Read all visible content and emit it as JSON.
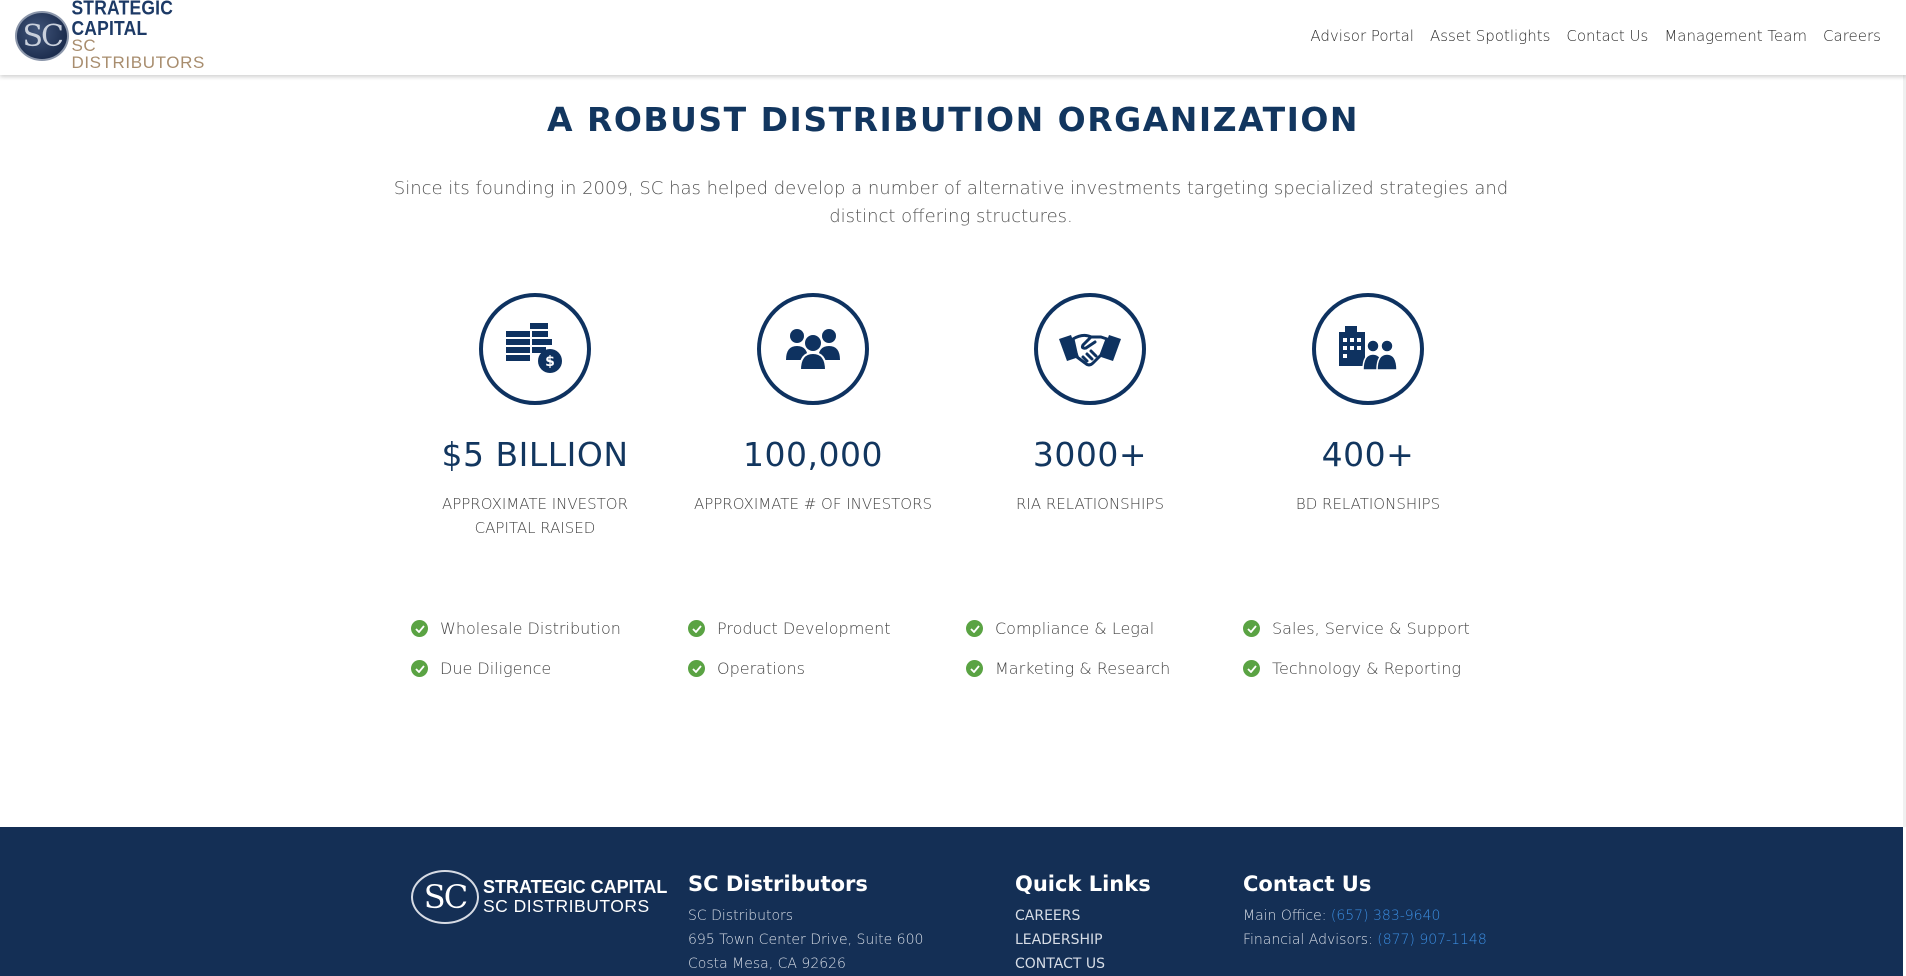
{
  "header": {
    "logo": {
      "mark": "SC",
      "line1": "STRATEGIC CAPITAL",
      "line2": "SC DISTRIBUTORS"
    },
    "nav": [
      "Advisor Portal",
      "Asset Spotlights",
      "Contact Us",
      "Management Team",
      "Careers"
    ]
  },
  "main": {
    "heading": "A ROBUST DISTRIBUTION ORGANIZATION",
    "intro": "Since its founding in 2009, SC has helped develop a number of alternative investments targeting specialized strategies and distinct offering structures.",
    "stats": [
      {
        "icon": "money-stack-icon",
        "value": "$5 BILLION",
        "label": "APPROXIMATE INVESTOR CAPITAL RAISED"
      },
      {
        "icon": "people-group-icon",
        "value": "100,000",
        "label": "APPROXIMATE # OF INVESTORS"
      },
      {
        "icon": "handshake-icon",
        "value": "3000+",
        "label": "RIA RELATIONSHIPS"
      },
      {
        "icon": "building-people-icon",
        "value": "400+",
        "label": "BD RELATIONSHIPS"
      }
    ],
    "checklist": [
      [
        "Wholesale Distribution",
        "Due Diligence"
      ],
      [
        "Product Development",
        "Operations"
      ],
      [
        "Compliance & Legal",
        "Marketing & Research"
      ],
      [
        "Sales, Service & Support",
        "Technology & Reporting"
      ]
    ]
  },
  "footer": {
    "logo": {
      "mark": "SC",
      "line1": "STRATEGIC CAPITAL",
      "line2": "SC DISTRIBUTORS"
    },
    "company": {
      "title": "SC Distributors",
      "lines": [
        "SC Distributors",
        "695 Town Center Drive, Suite 600",
        "Costa Mesa, CA 92626"
      ]
    },
    "quick_links": {
      "title": "Quick Links",
      "links": [
        "CAREERS",
        "LEADERSHIP",
        "CONTACT US"
      ]
    },
    "contact": {
      "title": "Contact Us",
      "main_label": "Main Office:",
      "main_phone": "(657) 383-9640",
      "advisors_label": "Financial Advisors:",
      "advisors_phone": "(877) 907-1148"
    }
  },
  "colors": {
    "navy": "#12365f",
    "footer_bg": "#142f55",
    "check_green": "#5aa343",
    "link_blue": "#3b8de0",
    "logo_gold": "#a88d6e"
  }
}
